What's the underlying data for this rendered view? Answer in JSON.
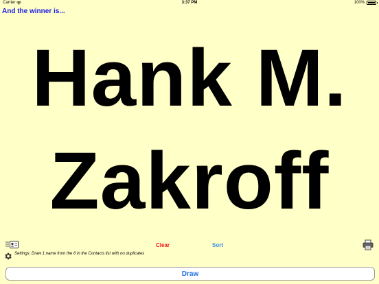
{
  "status_bar": {
    "carrier": "Carrier",
    "time": "3:37 PM",
    "battery_percent": "100%",
    "battery_level": 1.0
  },
  "header": {
    "title": "And the winner is..."
  },
  "winner": {
    "line1": "Hank M.",
    "line2": "Zakroff"
  },
  "toolbar": {
    "contacts_icon": "contacts-list-icon",
    "clear_label": "Clear",
    "sort_label": "Sort",
    "print_icon": "printer-icon"
  },
  "settings": {
    "icon": "gear-icon",
    "text": "Settings: Draw 1 name from the 6 in the Contacts list with no duplicates"
  },
  "footer": {
    "draw_label": "Draw"
  },
  "colors": {
    "background": "#ffffc8",
    "heading_blue": "#1a1ae6",
    "clear_red": "#ee1111",
    "sort_blue": "#3a8de8",
    "draw_blue": "#1e6fe0"
  }
}
